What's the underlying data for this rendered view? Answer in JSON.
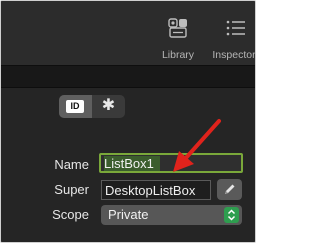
{
  "toolbar": {
    "library_label": "Library",
    "inspector_label": "Inspector",
    "library_icon": "library-icon",
    "inspector_icon": "list-icon"
  },
  "inspector": {
    "tabs": [
      {
        "icon": "id-icon",
        "label": "ID",
        "selected": true
      },
      {
        "icon": "gear-icon",
        "selected": false
      }
    ],
    "fields": {
      "name_label": "Name",
      "name_value": "ListBox1",
      "super_label": "Super",
      "super_value": "DesktopListBox",
      "scope_label": "Scope",
      "scope_value": "Private"
    }
  },
  "colors": {
    "focus_ring": "#7aa83a",
    "stepper": "#2e9e4f",
    "annotation_arrow": "#e0231c"
  }
}
